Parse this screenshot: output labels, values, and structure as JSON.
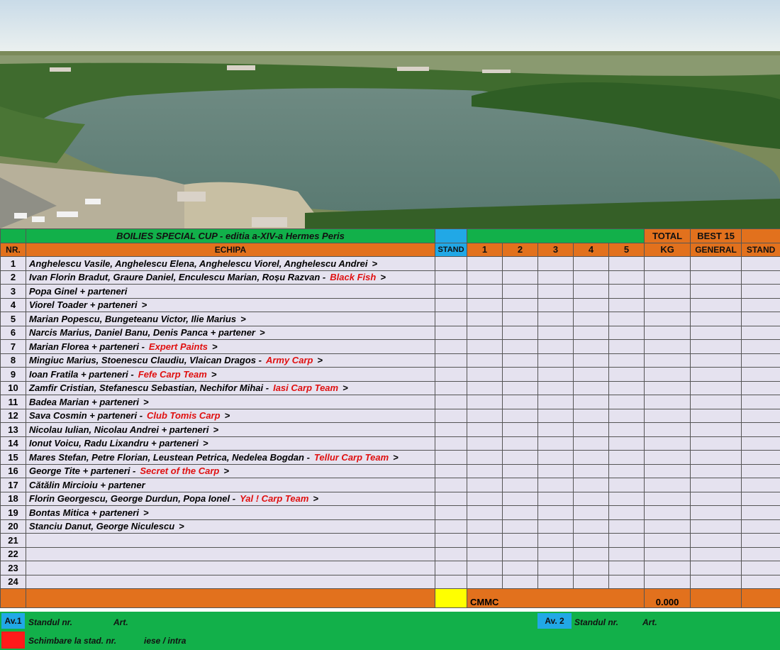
{
  "header": {
    "title": "BOILIES SPECIAL CUP - editia a-XIV-a Hermes Peris",
    "nr": "NR.",
    "echipa": "ECHIPA",
    "stand": "STAND",
    "rounds": [
      "1",
      "2",
      "3",
      "4",
      "5"
    ],
    "total_top": "TOTAL",
    "total_bottom": "KG",
    "best_top": "BEST 15",
    "best_bottom": "GENERAL",
    "stand_right": "STAND"
  },
  "rows": [
    {
      "nr": "1",
      "names": "Anghelescu Vasile, Anghelescu Elena, Anghelescu Viorel, Anghelescu Andrei",
      "team": "",
      "arrow": ">"
    },
    {
      "nr": "2",
      "names": "Ivan Florin Bradut, Graure Daniel, Enculescu Marian, Roșu Razvan -",
      "team": "Black Fish",
      "arrow": ">"
    },
    {
      "nr": "3",
      "names": "Popa Ginel + parteneri",
      "team": "",
      "arrow": ""
    },
    {
      "nr": "4",
      "names": "Viorel Toader + parteneri",
      "team": "",
      "arrow": ">"
    },
    {
      "nr": "5",
      "names": "Marian Popescu, Bungeteanu Victor, Ilie Marius",
      "team": "",
      "arrow": ">"
    },
    {
      "nr": "6",
      "names": "Narcis Marius, Daniel Banu, Denis Panca + partener",
      "team": "",
      "arrow": ">"
    },
    {
      "nr": "7",
      "names": "Marian Florea + parteneri -",
      "team": "Expert Paints",
      "arrow": ">"
    },
    {
      "nr": "8",
      "names": "Mingiuc Marius, Stoenescu Claudiu, Vlaican Dragos -",
      "team": "Army Carp",
      "arrow": ">"
    },
    {
      "nr": "9",
      "names": "Ioan Fratila + parteneri -",
      "team": "Fefe Carp Team",
      "arrow": ">"
    },
    {
      "nr": "10",
      "names": "Zamfir Cristian, Stefanescu Sebastian, Nechifor Mihai -",
      "team": "Iasi Carp Team",
      "arrow": ">"
    },
    {
      "nr": "11",
      "names": "Badea Marian + parteneri",
      "team": "",
      "arrow": ">"
    },
    {
      "nr": "12",
      "names": "Sava Cosmin + parteneri -",
      "team": "Club Tomis Carp",
      "arrow": ">"
    },
    {
      "nr": "13",
      "names": "Nicolau Iulian, Nicolau Andrei + parteneri",
      "team": "",
      "arrow": ">"
    },
    {
      "nr": "14",
      "names": "Ionut Voicu, Radu Lixandru + parteneri",
      "team": "",
      "arrow": ">"
    },
    {
      "nr": "15",
      "names": "Mares Stefan, Petre Florian, Leustean Petrica, Nedelea Bogdan -",
      "team": "Tellur Carp Team",
      "arrow": ">"
    },
    {
      "nr": "16",
      "names": "George Tite + parteneri -",
      "team": "Secret of the Carp",
      "arrow": ">"
    },
    {
      "nr": "17",
      "names": "Cătălin Mircioiu + partener",
      "team": "",
      "arrow": ""
    },
    {
      "nr": "18",
      "names": "Florin Georgescu, George Durdun, Popa Ionel -",
      "team": "Yal ! Carp Team",
      "arrow": ">"
    },
    {
      "nr": "19",
      "names": "Bontas Mitica + parteneri",
      "team": "",
      "arrow": ">"
    },
    {
      "nr": "20",
      "names": "Stanciu Danut, George Niculescu",
      "team": "",
      "arrow": ">"
    },
    {
      "nr": "21",
      "names": "",
      "team": "",
      "arrow": ""
    },
    {
      "nr": "22",
      "names": "",
      "team": "",
      "arrow": ""
    },
    {
      "nr": "23",
      "names": "",
      "team": "",
      "arrow": ""
    },
    {
      "nr": "24",
      "names": "",
      "team": "",
      "arrow": ""
    }
  ],
  "summary": {
    "label": "CMMC",
    "total": "0.000"
  },
  "footer": {
    "av1": "Av.1",
    "standul1": "Standul nr.",
    "art1": "Art.",
    "av2": "Av. 2",
    "standul2": "Standul  nr.",
    "art2": "Art.",
    "schimbare": "Schimbare la stad.  nr.",
    "iese": "iese / intra"
  },
  "colors": {
    "green": "#12b04a",
    "orange": "#e2711d",
    "blue": "#21a8e6",
    "yellow": "#ffff00",
    "red": "#ff1a1a",
    "cell": "#e5e2ef",
    "team_red": "#e01010"
  }
}
